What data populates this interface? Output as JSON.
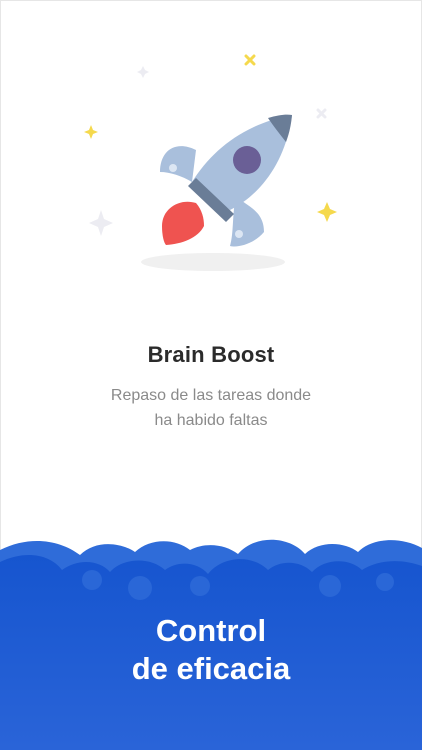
{
  "feature": {
    "title": "Brain Boost",
    "description_line1": "Repaso de las tareas donde",
    "description_line2": "ha habido faltas"
  },
  "banner": {
    "line1": "Control",
    "line2": "de eficacia"
  },
  "illustration": {
    "icon": "rocket-icon",
    "accent_colors": {
      "rocket_body": "#a9bfdc",
      "flame": "#ef5350",
      "window": "#6a5f96",
      "sparkle_yellow": "#f5d94d"
    }
  },
  "colors": {
    "banner_blue": "#1a5bd3",
    "title_text": "#2b2b2b",
    "subtitle_text": "#8a8a8a"
  }
}
